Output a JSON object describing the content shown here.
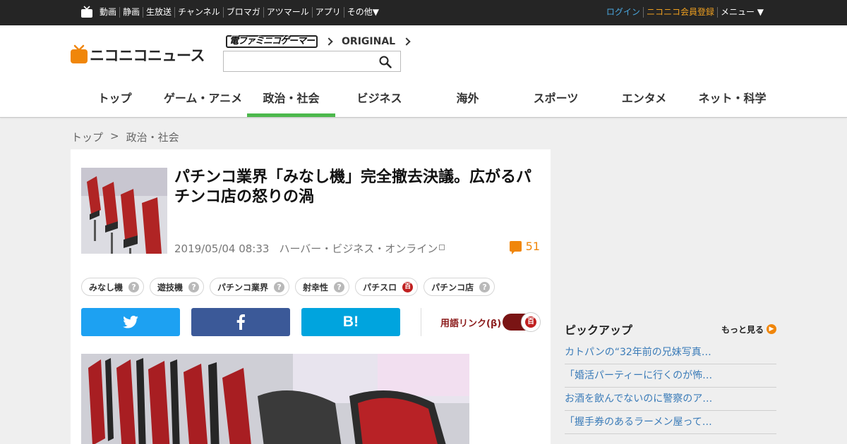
{
  "topbar": {
    "nav": [
      "動画",
      "静画",
      "生放送",
      "チャンネル",
      "ブロマガ",
      "アツマール",
      "アプリ",
      "その他▼"
    ],
    "login": "ログイン",
    "register": "ニコニコ会員登録",
    "menu": "メニュー ▼"
  },
  "header": {
    "logo_text": "ニコニコニュース",
    "sublinks": [
      "電ファミニコゲーマー",
      "ORIGINAL"
    ],
    "search": {
      "value": "",
      "placeholder": ""
    },
    "categories": [
      "トップ",
      "ゲーム・アニメ",
      "政治・社会",
      "ビジネス",
      "海外",
      "スポーツ",
      "エンタメ",
      "ネット・科学"
    ],
    "active_category": "政治・社会"
  },
  "breadcrumb": [
    "トップ",
    ">",
    "政治・社会"
  ],
  "article": {
    "title": "パチンコ業界「みなし機」完全撤去決議。広がるパチンコ店の怒りの渦",
    "datetime": "2019/05/04 08:33",
    "source": "ハーバー・ビジネス・オンライン",
    "comment_count": "51",
    "tags": [
      {
        "label": "みなし機",
        "badge": "?"
      },
      {
        "label": "遊技機",
        "badge": "?"
      },
      {
        "label": "パチンコ業界",
        "badge": "?"
      },
      {
        "label": "射幸性",
        "badge": "?"
      },
      {
        "label": "パチスロ",
        "badge": "百"
      },
      {
        "label": "パチンコ店",
        "badge": "?"
      }
    ],
    "share": {
      "hatena_label": "B!"
    },
    "term_link_label": "用語リンク(β)",
    "term_link_badge": "百"
  },
  "sidebar": {
    "pickup_title": "ピックアップ",
    "more_label": "もっと見る",
    "items": [
      "カトパンの“32年前の兄妹写真…",
      "「婚活パーティーに行くのが怖…",
      "お酒を飲んでないのに警察のア…",
      "「握手券のあるラーメン屋って…"
    ]
  },
  "colors": {
    "topbar_bg": "#252525",
    "active_underline": "#4cb84c",
    "accent_orange": "#f0860a",
    "twitter": "#1da1f2",
    "facebook": "#3b5998",
    "hatena": "#00a4de",
    "link": "#3a7bb8"
  }
}
